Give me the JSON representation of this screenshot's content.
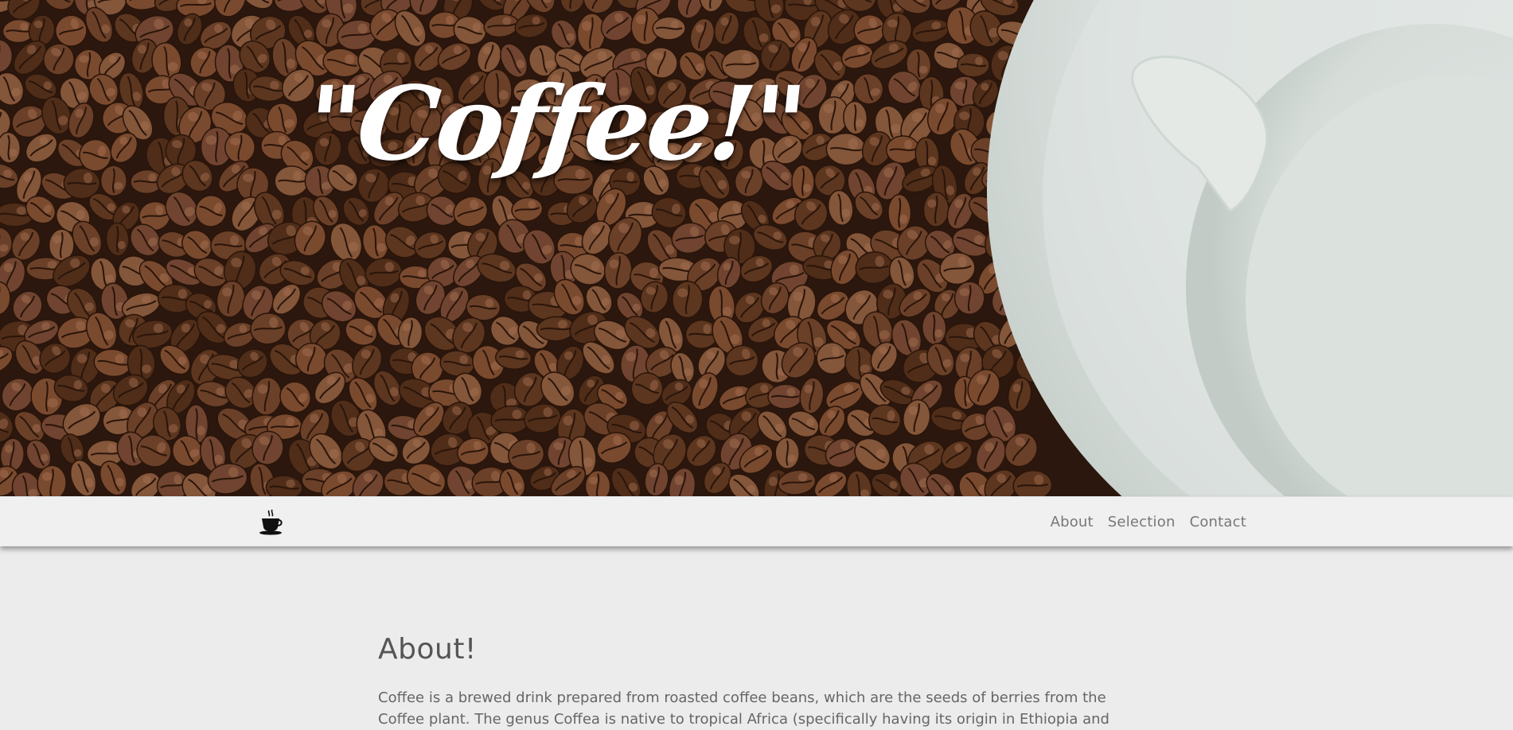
{
  "hero": {
    "title": "\"Coffee!\""
  },
  "navbar": {
    "logo_icon": "coffee-cup-icon",
    "links": [
      {
        "label": "About"
      },
      {
        "label": "Selection"
      },
      {
        "label": "Contact"
      }
    ]
  },
  "about": {
    "heading": "About!",
    "text": "Coffee is a brewed drink prepared from roasted coffee beans, which are the seeds of berries from the Coffee plant. The genus Coffea is native to tropical Africa (specifically having its origin in Ethiopia and"
  },
  "colors": {
    "background": "#ececec",
    "navbar": "#f0f0f0",
    "nav_text": "#777777",
    "heading_text": "#555555",
    "body_text": "#666666",
    "hero_title": "#ffffff"
  }
}
